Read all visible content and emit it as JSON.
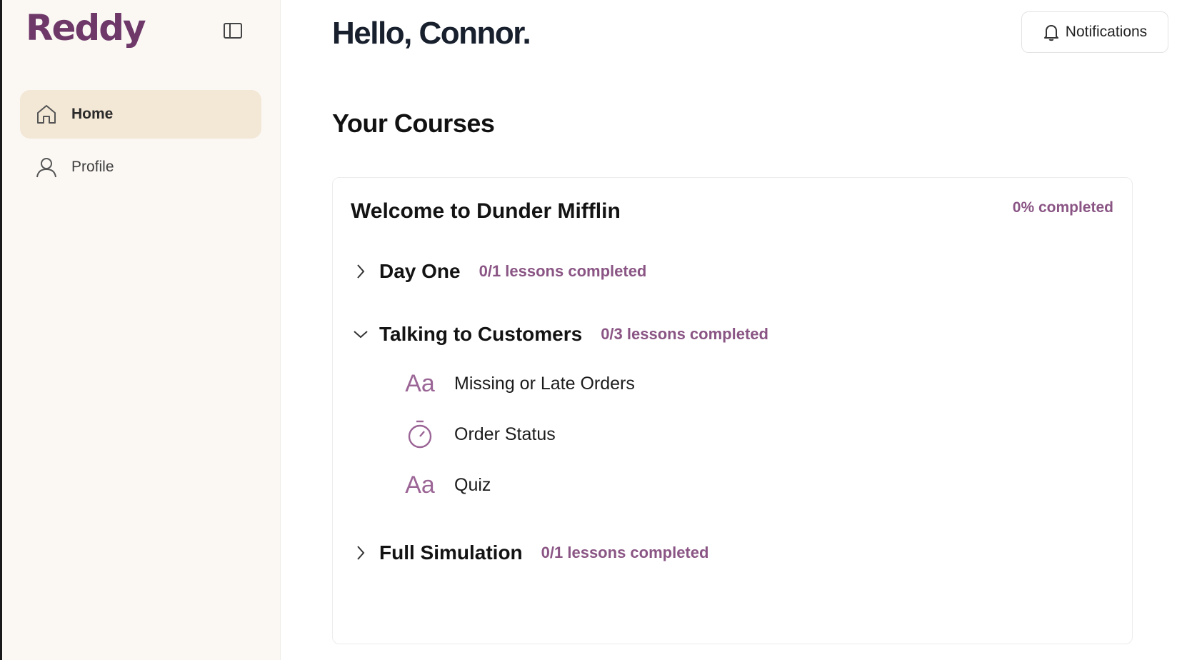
{
  "brand": {
    "logo_text": "Reddy",
    "color": "#6e3869"
  },
  "sidebar": {
    "items": [
      {
        "label": "Home",
        "icon": "home-icon",
        "active": true
      },
      {
        "label": "Profile",
        "icon": "user-icon",
        "active": false
      }
    ]
  },
  "header": {
    "greeting": "Hello, Connor.",
    "notifications_label": "Notifications"
  },
  "courses": {
    "section_title": "Your Courses",
    "course": {
      "title": "Welcome to Dunder Mifflin",
      "progress_label": "0% completed",
      "modules": [
        {
          "name": "Day One",
          "count_label": "0/1 lessons completed",
          "expanded": false
        },
        {
          "name": "Talking to Customers",
          "count_label": "0/3 lessons completed",
          "expanded": true,
          "lessons": [
            {
              "name": "Missing or Late Orders",
              "icon": "text-lesson-icon",
              "icon_glyph": "Aa"
            },
            {
              "name": "Order Status",
              "icon": "timer-icon"
            },
            {
              "name": "Quiz",
              "icon": "text-lesson-icon",
              "icon_glyph": "Aa"
            }
          ]
        },
        {
          "name": "Full Simulation",
          "count_label": "0/1 lessons completed",
          "expanded": false
        }
      ]
    }
  },
  "colors": {
    "accent": "#8a5584",
    "sidebar_bg": "#fbf8f4",
    "active_nav_bg": "#f3e7d6"
  }
}
